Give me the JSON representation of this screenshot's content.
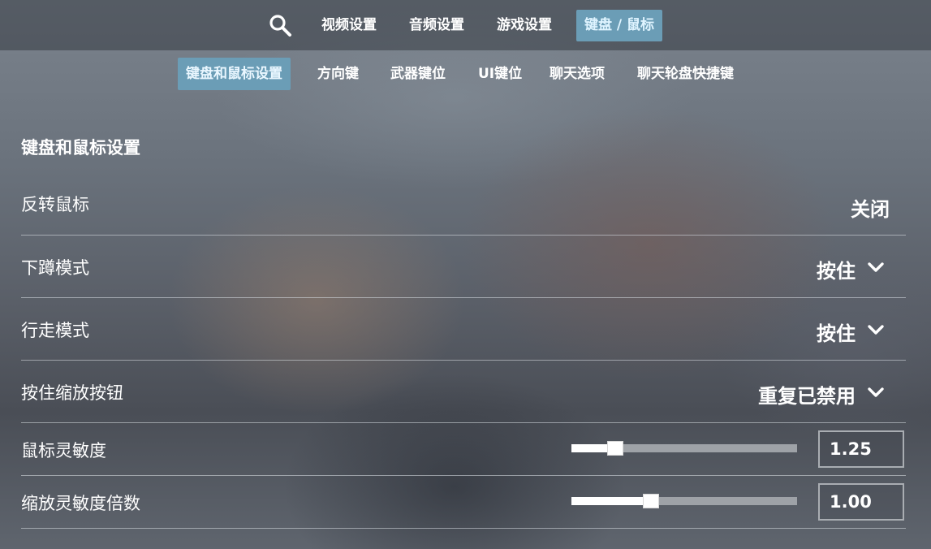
{
  "top_nav": {
    "tabs": [
      {
        "label": "视频设置",
        "active": false
      },
      {
        "label": "音频设置",
        "active": false
      },
      {
        "label": "游戏设置",
        "active": false
      },
      {
        "label": "键盘 / 鼠标",
        "active": true
      }
    ],
    "search_icon": "search-icon"
  },
  "sub_nav": {
    "tabs": [
      {
        "label": "键盘和鼠标设置",
        "active": true
      },
      {
        "label": "方向键",
        "active": false
      },
      {
        "label": "武器键位",
        "active": false
      },
      {
        "label": "UI键位",
        "active": false
      },
      {
        "label": "聊天选项",
        "active": false
      },
      {
        "label": "聊天轮盘快捷键",
        "active": false
      }
    ]
  },
  "section": {
    "title": "键盘和鼠标设置",
    "settings": [
      {
        "label": "反转鼠标",
        "value": "关闭",
        "control": "toggle"
      },
      {
        "label": "下蹲模式",
        "value": "按住",
        "control": "dropdown",
        "icon": "chevron-down-icon"
      },
      {
        "label": "行走模式",
        "value": "按住",
        "control": "dropdown",
        "icon": "chevron-down-icon"
      },
      {
        "label": "按住缩放按钮",
        "value": "重复已禁用",
        "control": "dropdown",
        "icon": "chevron-down-icon"
      },
      {
        "label": "鼠标灵敏度",
        "value": "1.25",
        "control": "slider",
        "level": 0.17
      },
      {
        "label": "缩放灵敏度倍数",
        "value": "1.00",
        "control": "slider",
        "level": 0.34
      }
    ]
  },
  "colors": {
    "accent": "#6b9db6",
    "accent_text": "#dff4ff",
    "divider": "#dce1e8",
    "slider_track": "#9ea2a7"
  }
}
